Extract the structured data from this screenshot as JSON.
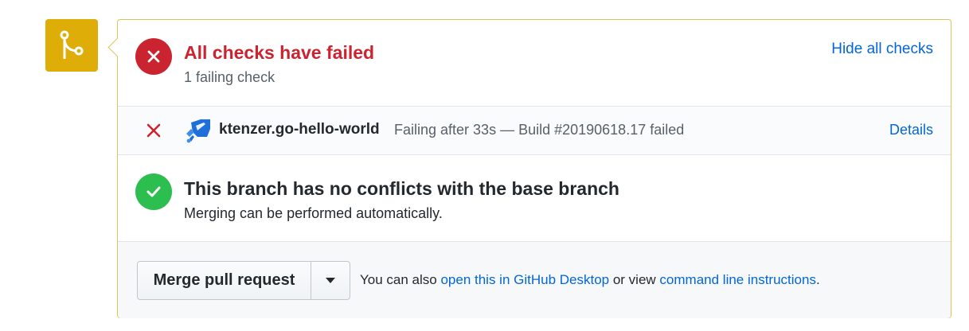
{
  "colors": {
    "badge": "#dfad08",
    "failure": "#cb2431",
    "success": "#2cbe4e",
    "link": "#0366d6",
    "panel_border": "#dbc55a"
  },
  "icons": {
    "badge": "git-merge-icon",
    "failure": "x-icon",
    "success": "check-icon",
    "check_app": "azure-pipelines-icon",
    "dropdown": "triangle-down-icon"
  },
  "checks": {
    "title": "All checks have failed",
    "subtitle": "1 failing check",
    "toggle_label": "Hide all checks"
  },
  "check_items": [
    {
      "name": "ktenzer.go-hello-world",
      "description": "Failing after 33s — Build #20190618.17 failed",
      "details_label": "Details"
    }
  ],
  "conflicts": {
    "title": "This branch has no conflicts with the base branch",
    "subtitle": "Merging can be performed automatically."
  },
  "merge": {
    "button_label": "Merge pull request",
    "note_prefix": "You can also ",
    "desktop_link": "open this in GitHub Desktop",
    "note_middle": " or view ",
    "cli_link": "command line instructions",
    "note_suffix": "."
  }
}
